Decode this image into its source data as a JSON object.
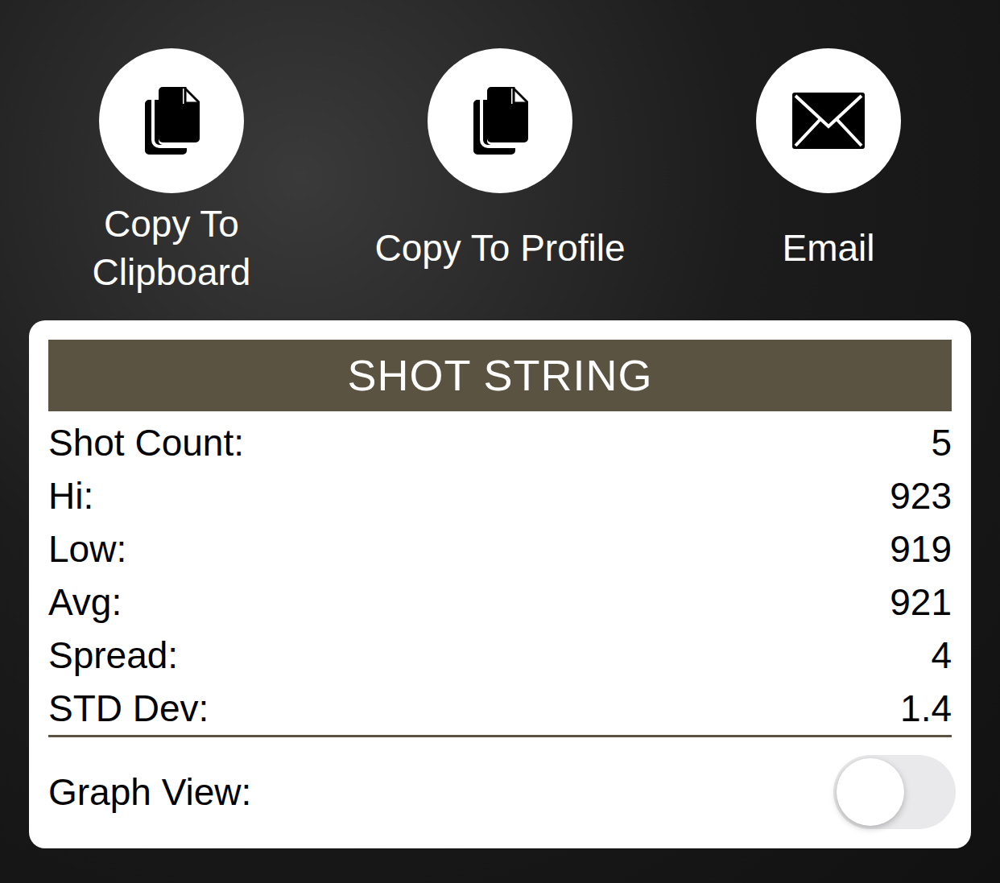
{
  "actions": [
    {
      "kind": "copy",
      "label_lines": [
        "Copy To",
        "Clipboard"
      ]
    },
    {
      "kind": "copy",
      "label_lines": [
        "Copy To Profile"
      ]
    },
    {
      "kind": "email",
      "label_lines": [
        "Email"
      ]
    }
  ],
  "shot_string": {
    "title": "SHOT STRING",
    "stats": [
      {
        "label": "Shot Count:",
        "value": "5"
      },
      {
        "label": "Hi:",
        "value": "923"
      },
      {
        "label": "Low:",
        "value": "919"
      },
      {
        "label": "Avg:",
        "value": "921"
      },
      {
        "label": "Spread:",
        "value": "4"
      },
      {
        "label": "STD Dev:",
        "value": "1.4"
      }
    ],
    "graph_view": {
      "label": "Graph View:",
      "on": false
    }
  }
}
